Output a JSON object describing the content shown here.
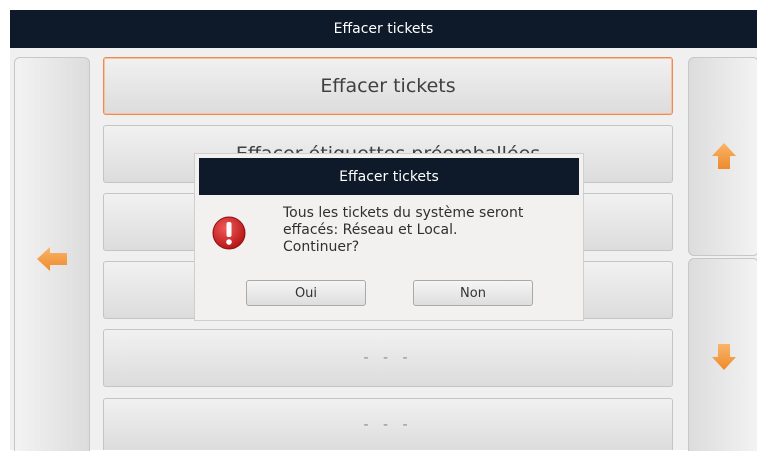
{
  "window": {
    "title": "Effacer tickets"
  },
  "nav": {
    "left_icon": "arrow-left-icon",
    "up_icon": "arrow-up-icon",
    "down_icon": "arrow-down-icon",
    "accent": "#f39a3c"
  },
  "menu": {
    "items": [
      {
        "label": "Effacer tickets",
        "selected": true
      },
      {
        "label": "Effacer étiquettes préemballées"
      },
      {
        "label": ""
      },
      {
        "label": ""
      },
      {
        "label": "- - -"
      },
      {
        "label": "- - -"
      }
    ]
  },
  "dialog": {
    "title": "Effacer tickets",
    "icon": "error-icon",
    "message": "Tous les tickets du système seront\neffacés: Réseau et Local.\nContinuer?",
    "yes_label": "Oui",
    "no_label": "Non"
  }
}
